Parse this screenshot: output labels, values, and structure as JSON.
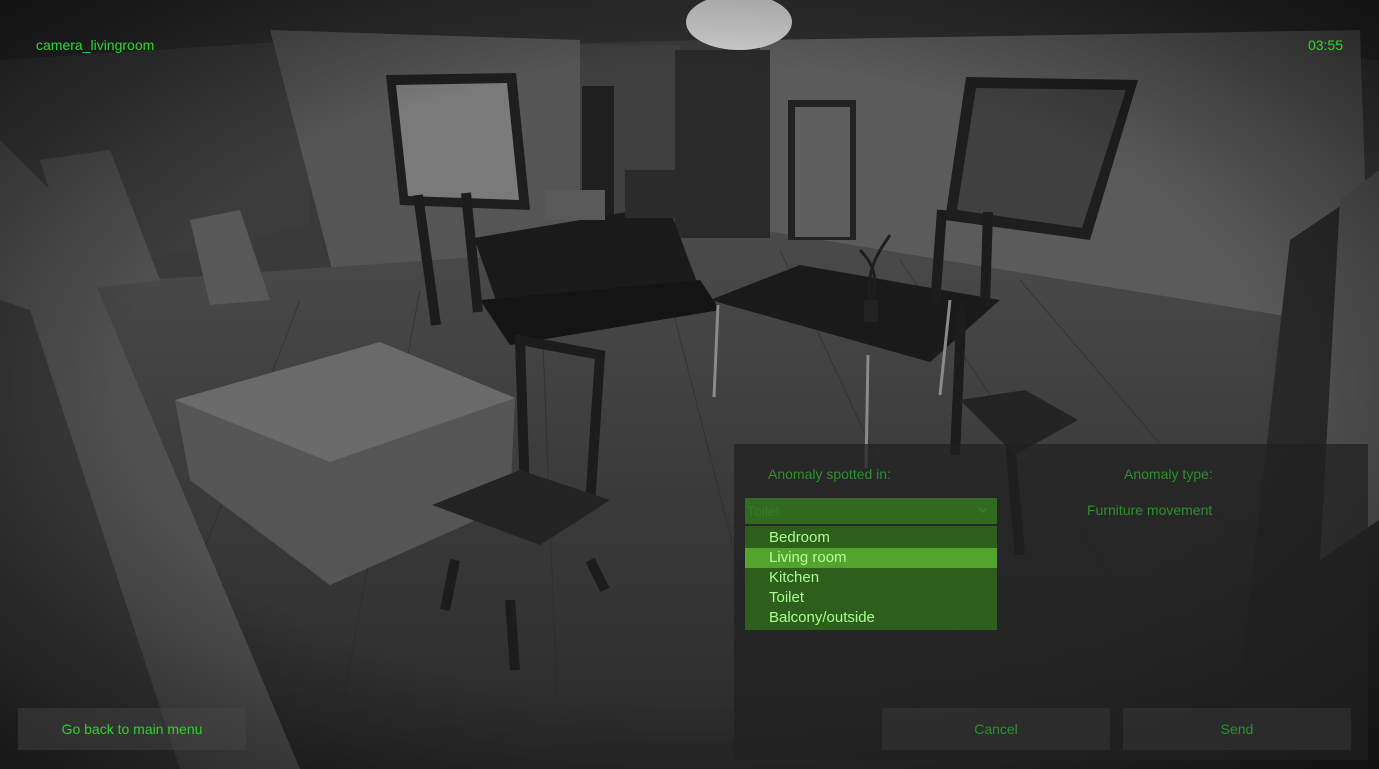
{
  "hud": {
    "camera": "camera_livingroom",
    "clock": "03:55"
  },
  "menu": {
    "back_label": "Go back to main menu"
  },
  "report": {
    "room_label": "Anomaly spotted in:",
    "type_label": "Anomaly type:",
    "room_selected": "Toilet",
    "type_selected": "Furniture movement",
    "room_options": [
      "Bedroom",
      "Living room",
      "Kitchen",
      "Toilet",
      "Balcony/outside"
    ],
    "highlighted_option": "Living room",
    "cancel_label": "Cancel",
    "send_label": "Send"
  },
  "colors": {
    "hud_green": "#35d335",
    "option_highlight": "#52a42d"
  }
}
